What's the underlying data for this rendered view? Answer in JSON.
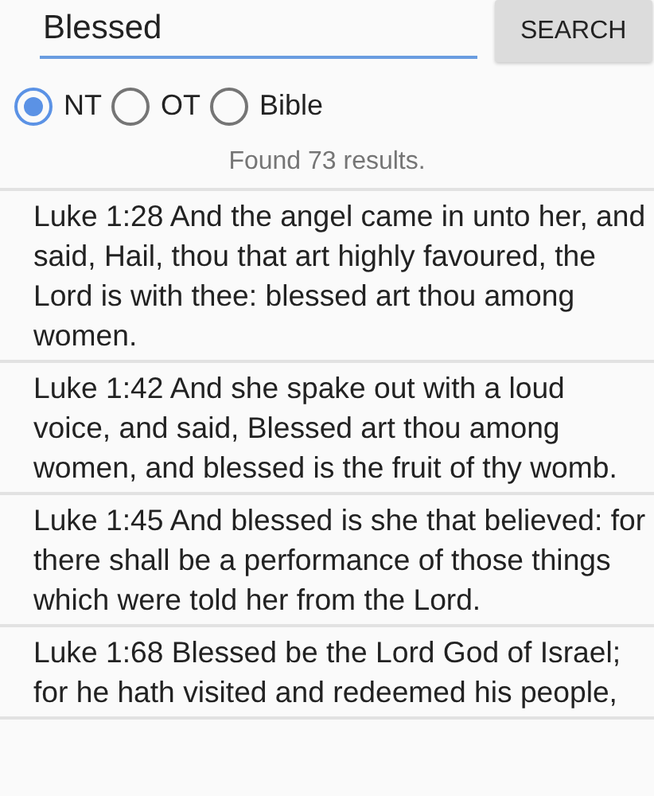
{
  "search": {
    "value": "Blessed",
    "button": "SEARCH"
  },
  "scope": [
    {
      "label": "NT",
      "selected": true
    },
    {
      "label": "OT",
      "selected": false
    },
    {
      "label": "Bible",
      "selected": false
    }
  ],
  "status": "Found 73 results.",
  "results": [
    {
      "text": "Luke 1:28 And the angel came in unto her, and said, Hail, thou that art highly favoured, the Lord is with thee: blessed art thou among women."
    },
    {
      "text": "Luke 1:42 And she spake out with a loud voice, and said, Blessed art thou among women, and blessed is the fruit of thy womb."
    },
    {
      "text": "Luke 1:45 And blessed is she that believed: for there shall be a performance of those things which were told her from the Lord."
    },
    {
      "text": "Luke 1:68 Blessed be the Lord God of Israel; for he hath visited and redeemed his people,"
    }
  ]
}
